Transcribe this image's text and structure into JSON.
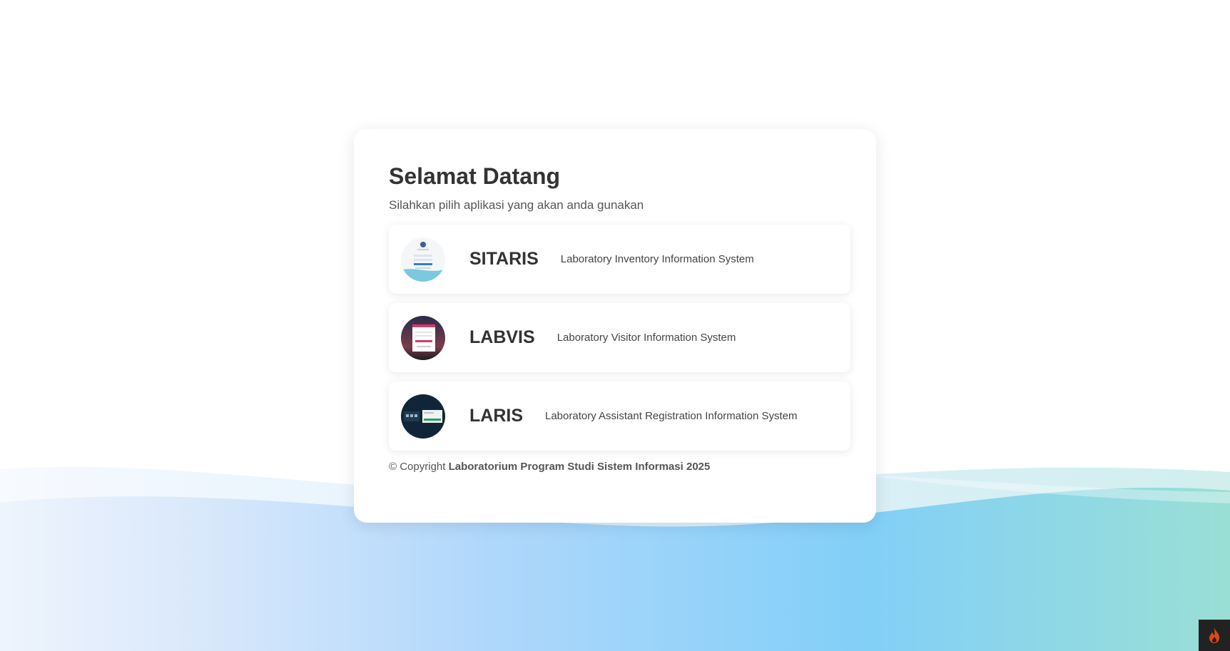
{
  "welcome": {
    "title": "Selamat Datang",
    "subtitle": "Silahkan pilih aplikasi yang akan anda gunakan"
  },
  "apps": [
    {
      "name": "SITARIS",
      "description": "Laboratory Inventory Information System",
      "thumbnail": "sitaris-screenshot"
    },
    {
      "name": "LABVIS",
      "description": "Laboratory Visitor Information System",
      "thumbnail": "labvis-screenshot"
    },
    {
      "name": "LARIS",
      "description": "Laboratory Assistant Registration Information System",
      "thumbnail": "laris-screenshot"
    }
  ],
  "footer": {
    "prefix": "© Copyright",
    "org": "Laboratorium Program Studi Sistem Informasi 2025"
  },
  "debug_toolbar": {
    "icon": "flame-icon"
  },
  "colors": {
    "wave_left": "#eef4fd",
    "wave_mid": "#82cff8",
    "wave_right": "#9adfd5",
    "flame": "#dd4814"
  }
}
